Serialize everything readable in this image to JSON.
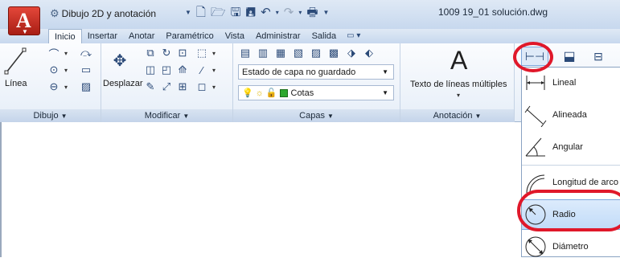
{
  "titlebar": {
    "workspace": "Dibujo 2D y anotación",
    "doc_title": "1009 19_01 solución.dwg"
  },
  "tabs": [
    {
      "label": "Inicio",
      "active": true
    },
    {
      "label": "Insertar"
    },
    {
      "label": "Anotar"
    },
    {
      "label": "Paramétrico"
    },
    {
      "label": "Vista"
    },
    {
      "label": "Administrar"
    },
    {
      "label": "Salida"
    }
  ],
  "ribbon": {
    "dibujo": {
      "title": "Dibujo",
      "linea_label": "Línea"
    },
    "modificar": {
      "title": "Modificar",
      "desplazar_label": "Desplazar"
    },
    "capas": {
      "title": "Capas",
      "layer_state": "Estado de capa no guardado",
      "current_layer": "Cotas",
      "layer_color": "#2ea82e"
    },
    "anotacion": {
      "title": "Anotación",
      "mtext_label": "Texto de líneas múltiples",
      "mtext_glyph": "A"
    }
  },
  "dimension_menu": {
    "items": [
      {
        "label": "Lineal",
        "icon": "dim-linear-icon"
      },
      {
        "label": "Alineada",
        "icon": "dim-aligned-icon"
      },
      {
        "label": "Angular",
        "icon": "dim-angular-icon"
      },
      {
        "label": "Longitud de arco",
        "icon": "dim-arc-length-icon"
      },
      {
        "label": "Radio",
        "icon": "dim-radius-icon",
        "highlighted": true
      },
      {
        "label": "Diámetro",
        "icon": "dim-diameter-icon"
      }
    ]
  },
  "annotations": {
    "highlight_color": "#e0182a"
  }
}
